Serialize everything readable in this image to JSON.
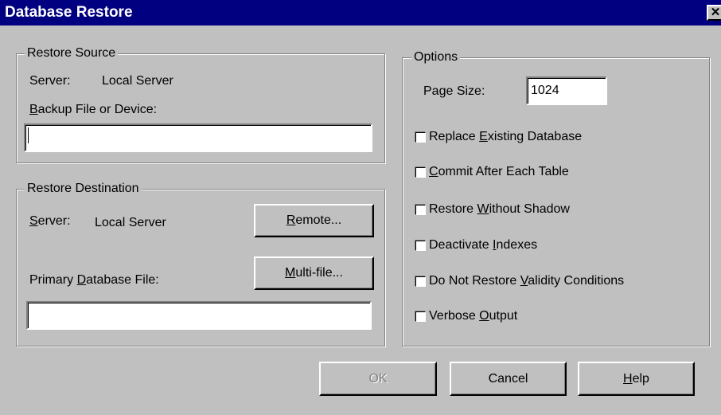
{
  "window": {
    "title": "Database Restore",
    "close_glyph": "✕"
  },
  "restore_source": {
    "legend": "Restore Source",
    "server_label": "Server:",
    "server_value": "Local Server",
    "backup_label_pre": "",
    "backup_label_u": "B",
    "backup_label_post": "ackup File or Device:",
    "backup_value": ""
  },
  "restore_destination": {
    "legend": "Restore Destination",
    "server_label_u": "S",
    "server_label_post": "erver:",
    "server_value": "Local Server",
    "remote_u": "R",
    "remote_post": "emote...",
    "primary_label_pre": "Primary ",
    "primary_label_u": "D",
    "primary_label_post": "atabase File:",
    "multifile_u": "M",
    "multifile_post": "ulti-file...",
    "primary_value": ""
  },
  "options": {
    "legend": "Options",
    "page_size_pre": "Pa",
    "page_size_u": "g",
    "page_size_post": "e Size:",
    "page_size_value": "1024",
    "checkboxes": [
      {
        "pre": "Replace ",
        "u": "E",
        "post": "xisting Database",
        "checked": false
      },
      {
        "pre": "",
        "u": "C",
        "post": "ommit After Each Table",
        "checked": false
      },
      {
        "pre": "Restore ",
        "u": "W",
        "post": "ithout Shadow",
        "checked": false
      },
      {
        "pre": "Deactivate ",
        "u": "I",
        "post": "ndexes",
        "checked": false
      },
      {
        "pre": "Do Not Restore ",
        "u": "V",
        "post": "alidity Conditions",
        "checked": false
      },
      {
        "pre": "Verbose ",
        "u": "O",
        "post": "utput",
        "checked": false
      }
    ]
  },
  "buttons": {
    "ok": "OK",
    "cancel": "Cancel",
    "help_u": "H",
    "help_post": "elp"
  }
}
